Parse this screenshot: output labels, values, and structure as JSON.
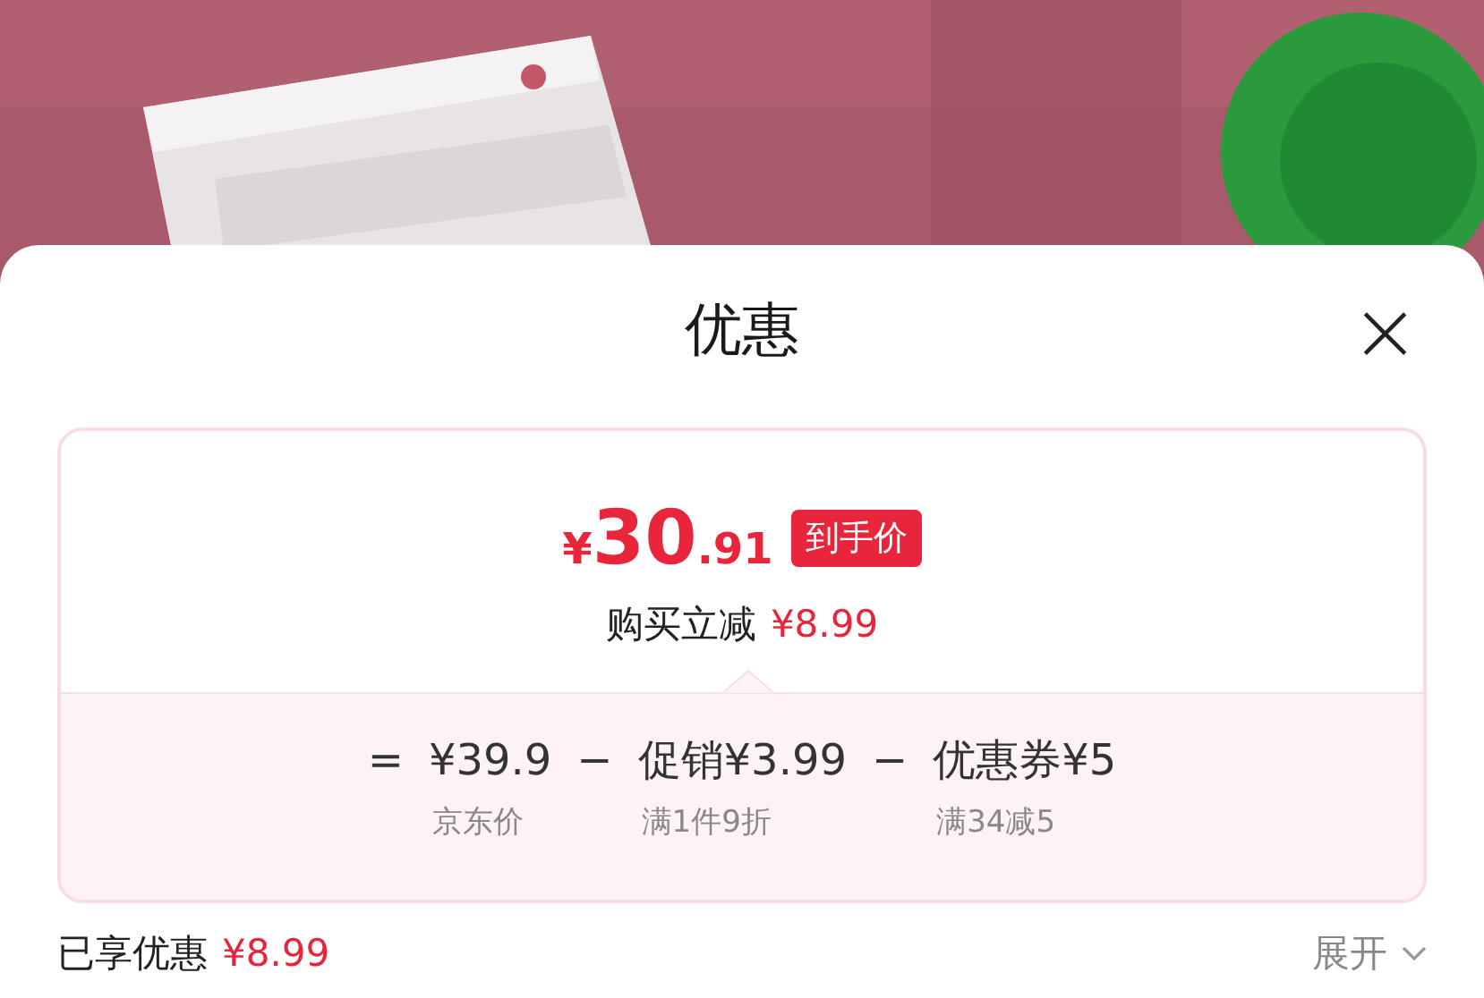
{
  "sheet": {
    "title": "优惠",
    "close": "×"
  },
  "price_card": {
    "currency": "¥",
    "integer": "30",
    "decimal": ".91",
    "badge": "到手价",
    "saving_label": "购买立减",
    "saving_amount": "¥8.99",
    "formula": [
      {
        "kind": "operator",
        "text": "="
      },
      {
        "kind": "term",
        "amount": "¥39.9",
        "note": "京东价"
      },
      {
        "kind": "operator",
        "text": "−"
      },
      {
        "kind": "term",
        "prefix": "促销",
        "amount": "¥3.99",
        "note": "满1件9折"
      },
      {
        "kind": "operator",
        "text": "−"
      },
      {
        "kind": "term",
        "prefix": "优惠券",
        "amount": "¥5",
        "note": "满34减5"
      }
    ]
  },
  "summary": {
    "label": "已享优惠",
    "amount": "¥8.99",
    "toggle": "展开",
    "expanded": false
  }
}
